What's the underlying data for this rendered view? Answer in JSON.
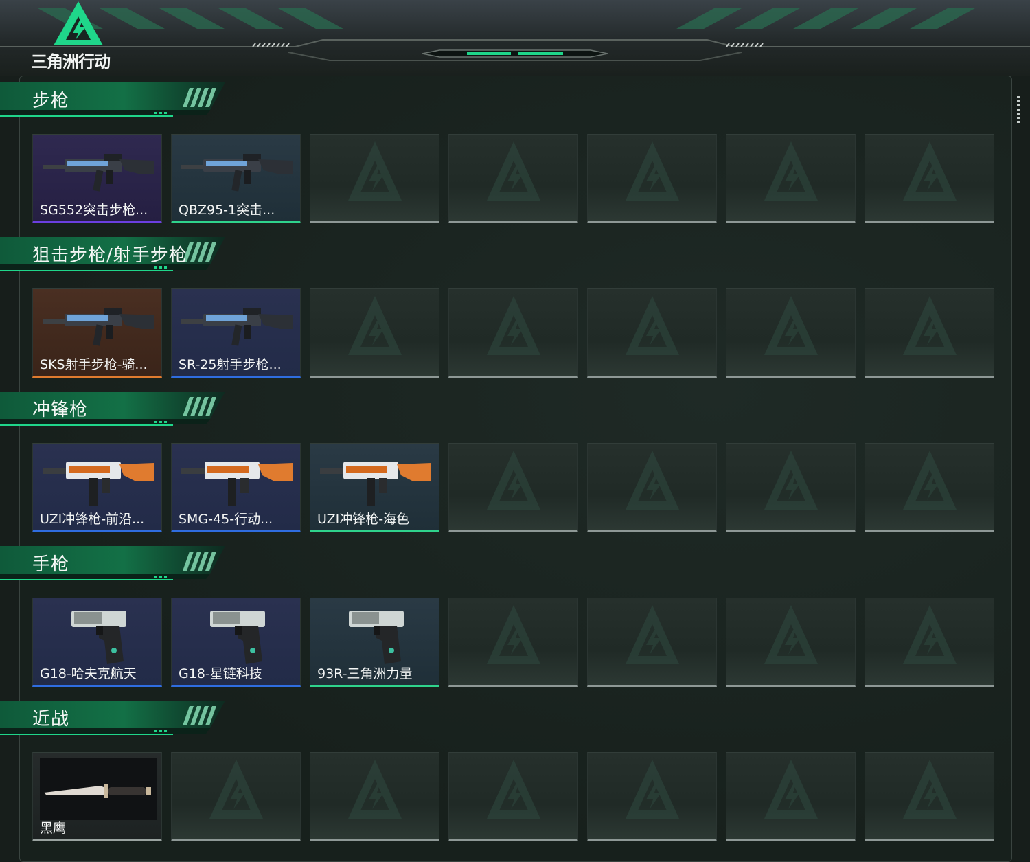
{
  "header": {
    "logo_text": "三角洲行动"
  },
  "sections": [
    {
      "title": "步枪",
      "items": [
        {
          "name": "SG552突击步枪...",
          "rarity": "purple",
          "color": "#6b3fe0",
          "icon": "assault-rifle-icon"
        },
        {
          "name": "QBZ95-1突击...",
          "rarity": "green",
          "color": "#2fd38c",
          "icon": "bullpup-rifle-icon"
        }
      ]
    },
    {
      "title": "狙击步枪/射手步枪",
      "items": [
        {
          "name": "SKS射手步枪-骑...",
          "rarity": "orange",
          "color": "#e07b2f",
          "icon": "marksman-rifle-icon"
        },
        {
          "name": "SR-25射手步枪...",
          "rarity": "blue",
          "color": "#2f6de0",
          "icon": "marksman-rifle-icon"
        }
      ]
    },
    {
      "title": "冲锋枪",
      "items": [
        {
          "name": "UZI冲锋枪-前沿...",
          "rarity": "blue",
          "color": "#2f6de0",
          "icon": "smg-icon"
        },
        {
          "name": "SMG-45-行动...",
          "rarity": "blue",
          "color": "#2f6de0",
          "icon": "smg-icon"
        },
        {
          "name": "UZI冲锋枪-海色",
          "rarity": "green",
          "color": "#2fd38c",
          "icon": "smg-icon"
        }
      ]
    },
    {
      "title": "手枪",
      "items": [
        {
          "name": "G18-哈夫克航天",
          "rarity": "blue",
          "color": "#2f6de0",
          "icon": "pistol-icon"
        },
        {
          "name": "G18-星链科技",
          "rarity": "blue",
          "color": "#2f6de0",
          "icon": "pistol-icon"
        },
        {
          "name": "93R-三角洲力量",
          "rarity": "green",
          "color": "#2fd38c",
          "icon": "pistol-icon"
        }
      ]
    },
    {
      "title": "近战",
      "items": [
        {
          "name": "黑鹰",
          "rarity": "grey",
          "color": "#9aa3a0",
          "icon": "knife-icon"
        }
      ]
    }
  ],
  "slots_per_row": 7,
  "accent_color": "#1fd68a"
}
